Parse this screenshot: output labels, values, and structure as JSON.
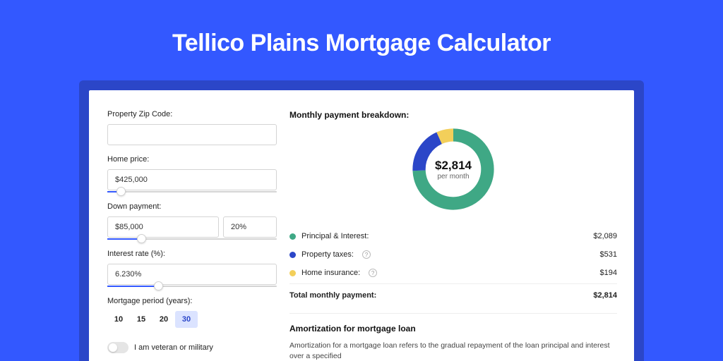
{
  "title": "Tellico Plains Mortgage Calculator",
  "colors": {
    "accent": "#3358ff",
    "pi": "#3fa885",
    "tax": "#2b46c8",
    "ins": "#f3cf5a"
  },
  "form": {
    "zip_label": "Property Zip Code:",
    "zip_value": "",
    "home_price_label": "Home price:",
    "home_price_value": "$425,000",
    "home_price_pct": 8,
    "down_label": "Down payment:",
    "down_value": "$85,000",
    "down_pct_value": "20%",
    "down_slider_pct": 20,
    "rate_label": "Interest rate (%):",
    "rate_value": "6.230%",
    "rate_slider_pct": 30,
    "period_label": "Mortgage period (years):",
    "periods": [
      "10",
      "15",
      "20",
      "30"
    ],
    "period_active": "30",
    "veteran_label": "I am veteran or military"
  },
  "breakdown": {
    "title": "Monthly payment breakdown:",
    "center_value": "$2,814",
    "center_sub": "per month",
    "rows": [
      {
        "key": "pi",
        "label": "Principal & Interest:",
        "value": "$2,089",
        "info": false
      },
      {
        "key": "tax",
        "label": "Property taxes:",
        "value": "$531",
        "info": true
      },
      {
        "key": "ins",
        "label": "Home insurance:",
        "value": "$194",
        "info": true
      }
    ],
    "total_label": "Total monthly payment:",
    "total_value": "$2,814"
  },
  "chart_data": {
    "type": "pie",
    "title": "Monthly payment breakdown",
    "series": [
      {
        "name": "Principal & Interest",
        "value": 2089,
        "color": "#3fa885"
      },
      {
        "name": "Property taxes",
        "value": 531,
        "color": "#2b46c8"
      },
      {
        "name": "Home insurance",
        "value": 194,
        "color": "#f3cf5a"
      }
    ],
    "total": 2814
  },
  "amortization": {
    "title": "Amortization for mortgage loan",
    "body": "Amortization for a mortgage loan refers to the gradual repayment of the loan principal and interest over a specified"
  }
}
